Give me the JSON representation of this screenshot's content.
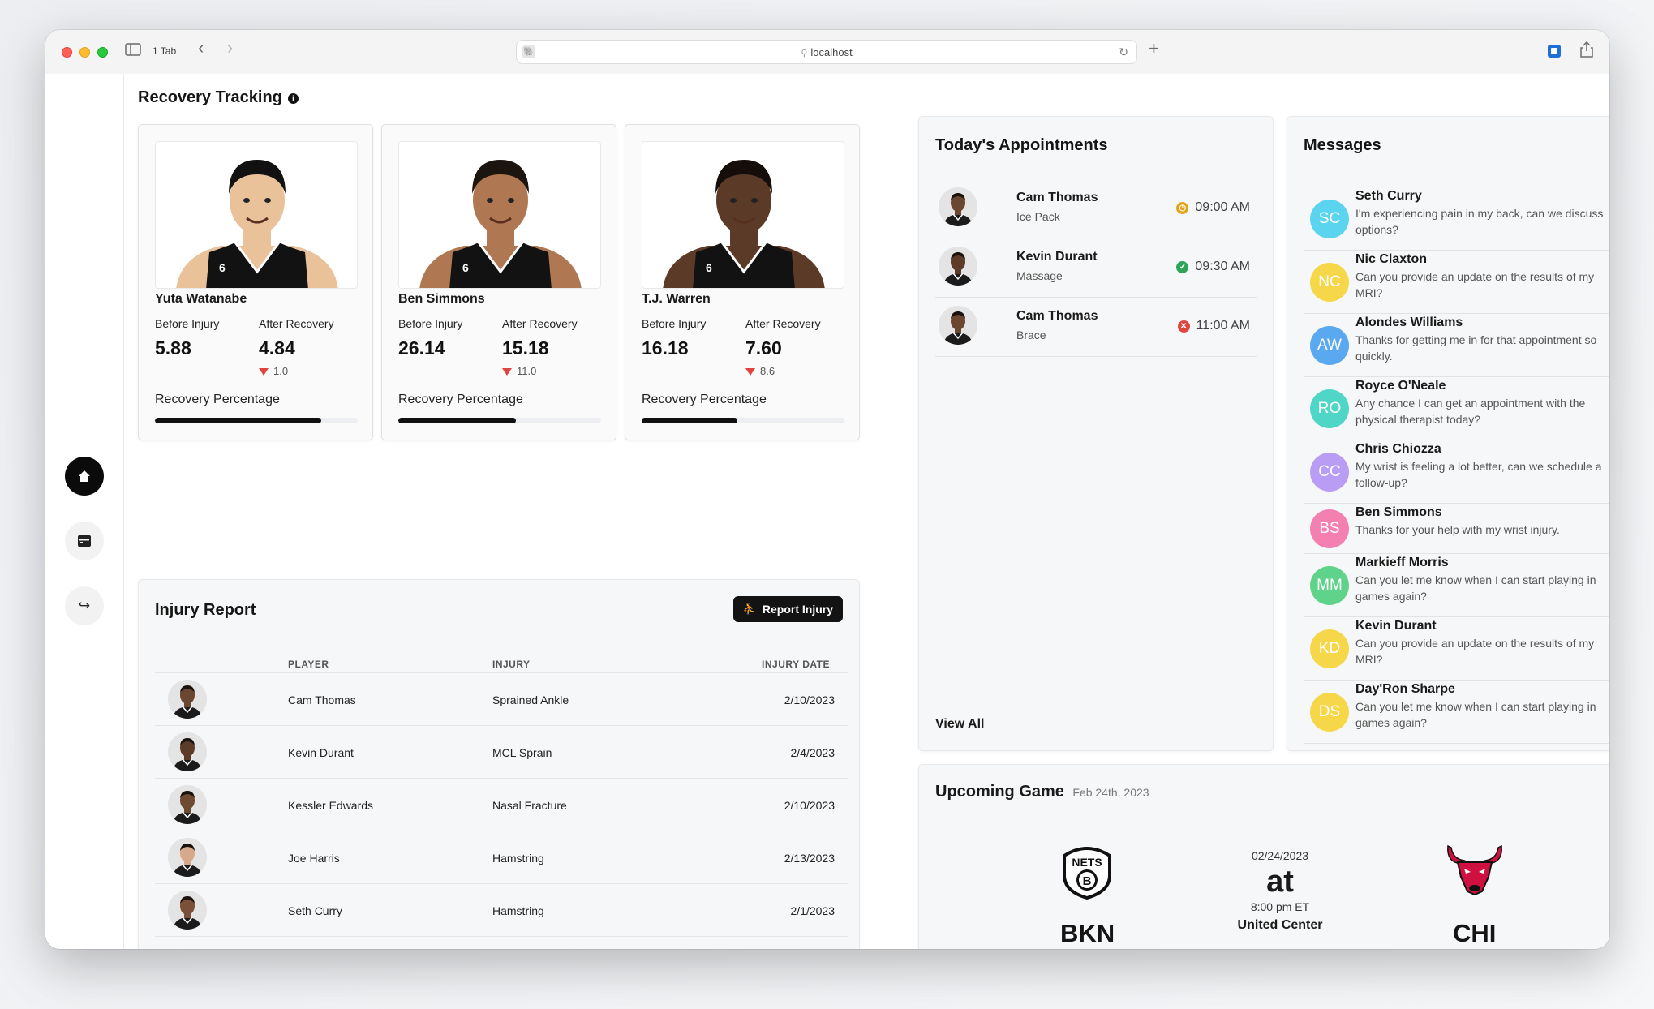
{
  "browser": {
    "tab_count": "1 Tab",
    "url": "localhost"
  },
  "recovery": {
    "title": "Recovery Tracking",
    "before_label": "Before Injury",
    "after_label": "After Recovery",
    "percentage_label": "Recovery Percentage",
    "players": [
      {
        "name": "Yuta Watanabe",
        "before": "5.88",
        "after": "4.84",
        "delta": "1.0",
        "recovery_pct": 82,
        "skin": "#e9c29a",
        "hair": "#111111"
      },
      {
        "name": "Ben Simmons",
        "before": "26.14",
        "after": "15.18",
        "delta": "11.0",
        "recovery_pct": 58,
        "skin": "#b07852",
        "hair": "#1c140f"
      },
      {
        "name": "T.J. Warren",
        "before": "16.18",
        "after": "7.60",
        "delta": "8.6",
        "recovery_pct": 47,
        "skin": "#5b3a28",
        "hair": "#140d09"
      }
    ]
  },
  "injury_report": {
    "title": "Injury Report",
    "button_label": "Report Injury",
    "columns": {
      "player": "PLAYER",
      "injury": "INJURY",
      "date": "INJURY DATE"
    },
    "rows": [
      {
        "player": "Cam Thomas",
        "injury": "Sprained Ankle",
        "date": "2/10/2023",
        "skin": "#6b4630"
      },
      {
        "player": "Kevin Durant",
        "injury": "MCL Sprain",
        "date": "2/4/2023",
        "skin": "#5c3b28"
      },
      {
        "player": "Kessler Edwards",
        "injury": "Nasal Fracture",
        "date": "2/10/2023",
        "skin": "#6e4a33"
      },
      {
        "player": "Joe Harris",
        "injury": "Hamstring",
        "date": "2/13/2023",
        "skin": "#d7a98a"
      },
      {
        "player": "Seth Curry",
        "injury": "Hamstring",
        "date": "2/1/2023",
        "skin": "#7a5138"
      }
    ]
  },
  "appointments": {
    "title": "Today's Appointments",
    "view_all": "View All",
    "items": [
      {
        "name": "Cam Thomas",
        "type": "Ice Pack",
        "time": "09:00 AM",
        "status": "pending",
        "status_color": "#e1a41a",
        "status_glyph": "◷"
      },
      {
        "name": "Kevin Durant",
        "type": "Massage",
        "time": "09:30 AM",
        "status": "confirmed",
        "status_color": "#2fa55a",
        "status_glyph": "✓"
      },
      {
        "name": "Cam Thomas",
        "type": "Brace",
        "time": "11:00 AM",
        "status": "cancelled",
        "status_color": "#e0443e",
        "status_glyph": "✕"
      }
    ]
  },
  "messages": {
    "title": "Messages",
    "items": [
      {
        "initials": "SC",
        "name": "Seth Curry",
        "text": "I'm experiencing pain in my back, can we discuss options?",
        "color": "#5bd4f0"
      },
      {
        "initials": "NC",
        "name": "Nic Claxton",
        "text": "Can you provide an update on the results of my MRI?",
        "color": "#f7d74a"
      },
      {
        "initials": "AW",
        "name": "Alondes Williams",
        "text": "Thanks for getting me in for that appointment so quickly.",
        "color": "#5aa8ef"
      },
      {
        "initials": "RO",
        "name": "Royce O'Neale",
        "text": "Any chance I can get an appointment with the physical therapist today?",
        "color": "#4fd6c6"
      },
      {
        "initials": "CC",
        "name": "Chris Chiozza",
        "text": "My wrist is feeling a lot better, can we schedule a follow-up?",
        "color": "#b99cf3"
      },
      {
        "initials": "BS",
        "name": "Ben Simmons",
        "text": "Thanks for your help with my wrist injury.",
        "color": "#f47fb1"
      },
      {
        "initials": "MM",
        "name": "Markieff Morris",
        "text": "Can you let me know when I can start playing in games again?",
        "color": "#5fd38a"
      },
      {
        "initials": "KD",
        "name": "Kevin Durant",
        "text": "Can you provide an update on the results of my MRI?",
        "color": "#f7d74a"
      },
      {
        "initials": "DS",
        "name": "Day'Ron Sharpe",
        "text": "Can you let me know when I can start playing in games again?",
        "color": "#f7d74a"
      }
    ]
  },
  "game": {
    "title": "Upcoming Game",
    "date_short": "Feb 24th, 2023",
    "date": "02/24/2023",
    "at": "at",
    "time": "8:00 pm ET",
    "venue": "United Center",
    "home": "BKN",
    "away": "CHI",
    "home_logo_text": "NETS",
    "home_logo_letter": "B"
  }
}
